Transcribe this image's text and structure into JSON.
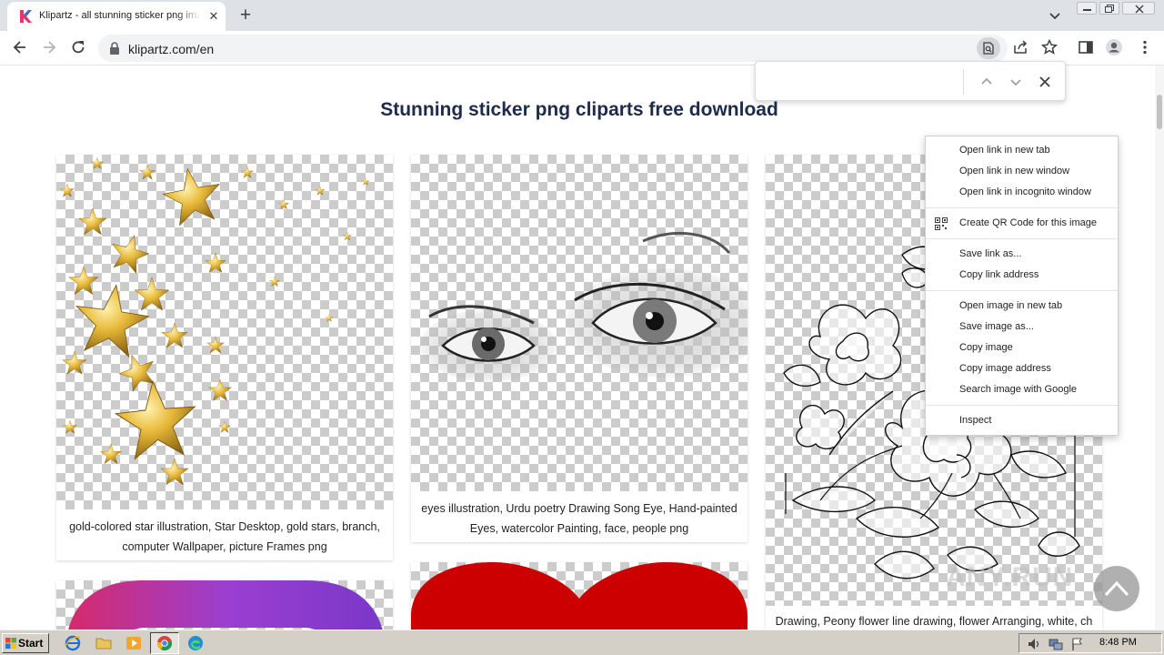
{
  "browser": {
    "tab_title": "Klipartz - all stunning sticker png images",
    "new_tab_symbol": "+",
    "close_tab_symbol": "✕",
    "url": "klipartz.com/en",
    "favicon_color": "#e8336b"
  },
  "find_bar": {
    "value": "",
    "prev_icon": "chevron-up-icon",
    "next_icon": "chevron-down-icon",
    "close_icon": "close-icon"
  },
  "page": {
    "heading": "Stunning sticker png cliparts free download",
    "cards": [
      {
        "caption": "gold-colored star illustration, Star Desktop, gold stars, branch, computer Wallpaper, picture Frames png"
      },
      {
        "caption": "eyes illustration, Urdu poetry Drawing Song Eye, Hand-painted Eyes, watercolor Painting, face, people png"
      },
      {
        "caption": "Drawing, Peony flower line drawing, flower Arranging, white, ch"
      }
    ]
  },
  "context_menu": {
    "groups": [
      [
        "Open link in new tab",
        "Open link in new window",
        "Open link in incognito window"
      ],
      [
        "Create QR Code for this image"
      ],
      [
        "Save link as...",
        "Copy link address"
      ],
      [
        "Open image in new tab",
        "Save image as...",
        "Copy image",
        "Copy image address",
        "Search image with Google"
      ],
      [
        "Inspect"
      ]
    ]
  },
  "watermark": {
    "text": "ANY.RUN"
  },
  "taskbar": {
    "start_label": "Start",
    "clock": "8:48 PM"
  },
  "colors": {
    "heading": "#1e2b4a",
    "heart_red": "#cc0000",
    "tab_strip": "#dee1e6",
    "taskbar": "#d4d0c8"
  }
}
